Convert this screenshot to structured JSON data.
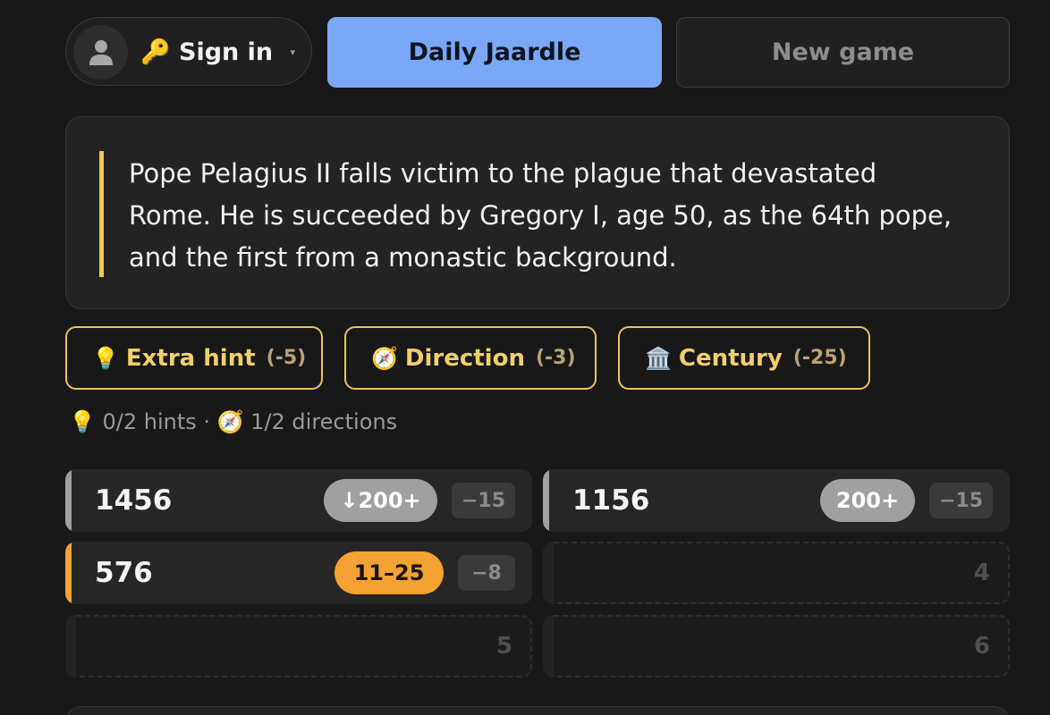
{
  "header": {
    "signin_emoji": "🔑",
    "signin_label": "Sign in",
    "caret": "▾",
    "daily_label": "Daily Jaardle",
    "new_game_label": "New game"
  },
  "clue": {
    "text": "Pope Pelagius II falls victim to the plague that devastated Rome. He is succeeded by Gregory I, age 50, as the 64th pope, and the first from a monastic background.",
    "accent_color": "#f2c94c"
  },
  "hints": [
    {
      "icon": "💡",
      "label": "Extra hint",
      "cost": "(-5)"
    },
    {
      "icon": "🧭",
      "label": "Direction",
      "cost": "(-3)"
    },
    {
      "icon": "🏛️",
      "label": "Century",
      "cost": "(-25)"
    }
  ],
  "stats": {
    "text": "💡 0/2 hints · 🧭 1/2 directions"
  },
  "guesses": [
    {
      "year": "1456",
      "badge": "↓200+",
      "penalty": "−15",
      "accent": "#a0a0a0"
    },
    {
      "year": "1156",
      "badge": "200+",
      "penalty": "−15",
      "accent": "#a0a0a0"
    },
    {
      "year": "576",
      "badge": "11–25",
      "penalty": "−8",
      "accent": "#f4a233"
    }
  ],
  "empty_slots": [
    "4",
    "5",
    "6"
  ],
  "colors": {
    "gray_badge": "#a0a0a0",
    "orange_badge": "#f4a233",
    "primary_button": "#7aa7f7",
    "hint_border": "#e9c45c"
  }
}
